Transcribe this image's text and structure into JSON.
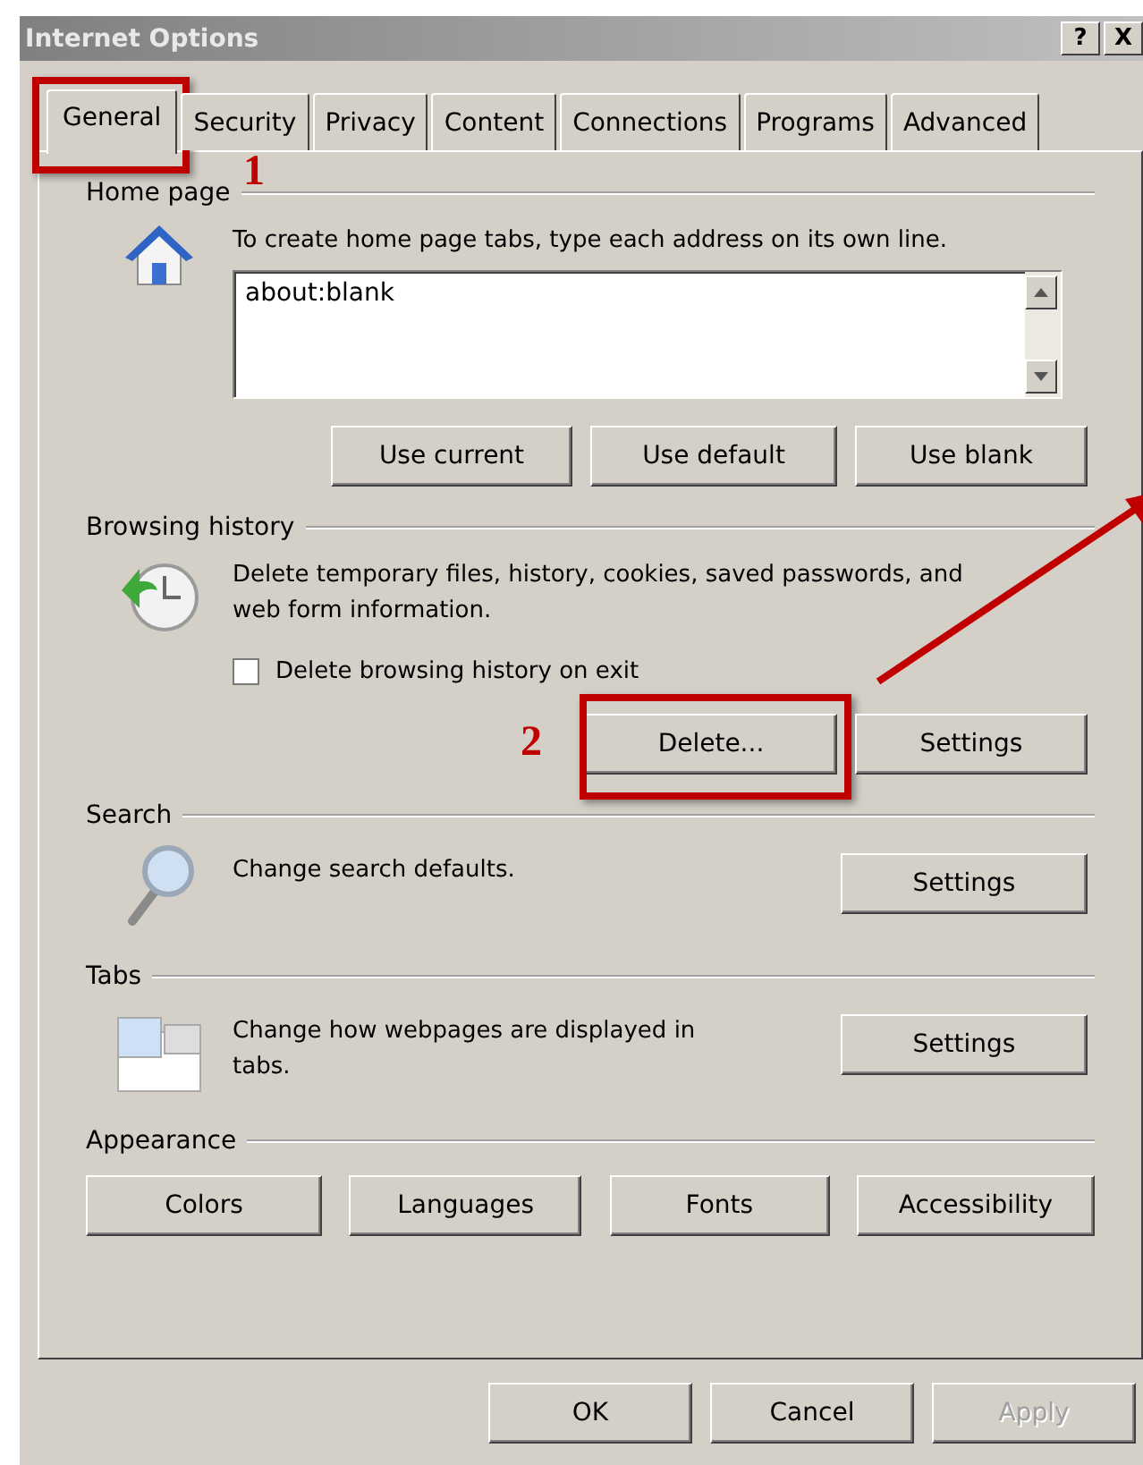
{
  "window": {
    "title": "Internet Options"
  },
  "title_buttons": [
    {
      "label": "?"
    },
    {
      "label": "X"
    }
  ],
  "tabs": [
    {
      "label": "General",
      "selected": true,
      "callout": "1"
    },
    {
      "label": "Security",
      "selected": false
    },
    {
      "label": "Privacy",
      "selected": false
    },
    {
      "label": "Content",
      "selected": false
    },
    {
      "label": "Connections",
      "selected": false
    },
    {
      "label": "Programs",
      "selected": false
    },
    {
      "label": "Advanced",
      "selected": false
    }
  ],
  "sections": [
    {
      "kind": "home",
      "heading": "Home page",
      "description": "To create home page tabs, type each address on its own line.",
      "addresses": "about:blank",
      "buttons": [
        {
          "label": "Use current"
        },
        {
          "label": "Use default"
        },
        {
          "label": "Use blank"
        }
      ]
    },
    {
      "kind": "history",
      "heading": "Browsing history",
      "description": "Delete temporary files, history, cookies, saved passwords, and web form information.",
      "checkbox": {
        "label": "Delete browsing history on exit",
        "checked": false
      },
      "buttons": [
        {
          "label": "Delete...",
          "callout": "2"
        },
        {
          "label": "Settings"
        }
      ]
    },
    {
      "kind": "search",
      "heading": "Search",
      "description": "Change search defaults.",
      "buttons": [
        {
          "label": "Settings"
        }
      ]
    },
    {
      "kind": "tabs",
      "heading": "Tabs",
      "description": "Change how webpages are displayed in tabs.",
      "buttons": [
        {
          "label": "Settings"
        }
      ]
    },
    {
      "kind": "appearance",
      "heading": "Appearance",
      "buttons": [
        {
          "label": "Colors"
        },
        {
          "label": "Languages"
        },
        {
          "label": "Fonts"
        },
        {
          "label": "Accessibility"
        }
      ]
    }
  ],
  "footer_buttons": [
    {
      "label": "OK",
      "disabled": false
    },
    {
      "label": "Cancel",
      "disabled": false
    },
    {
      "label": "Apply",
      "disabled": true
    }
  ]
}
